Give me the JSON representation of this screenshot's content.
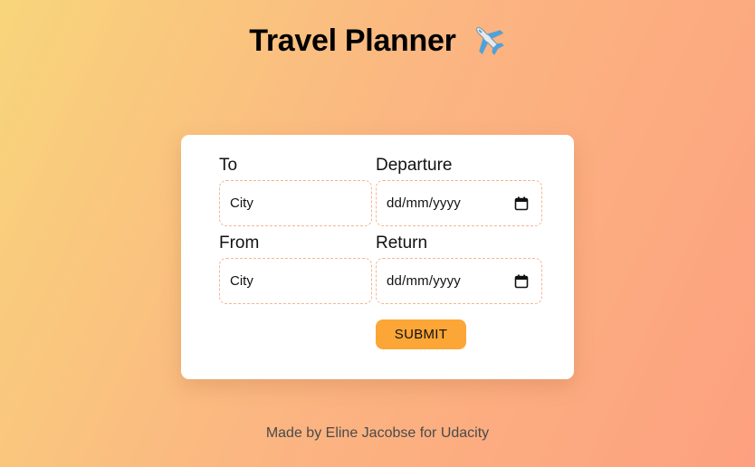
{
  "header": {
    "title": "Travel Planner",
    "icon": "airplane-icon"
  },
  "form": {
    "to_label": "To",
    "to_placeholder": "City",
    "departure_label": "Departure",
    "departure_value": "dd/mm/yyyy",
    "from_label": "From",
    "from_placeholder": "City",
    "return_label": "Return",
    "return_value": "dd/mm/yyyy",
    "submit_label": "SUBMIT"
  },
  "footer": {
    "text": "Made by Eline Jacobse for Udacity"
  },
  "colors": {
    "gradient_start": "#f8d57b",
    "gradient_end": "#fda07f",
    "card_bg": "#ffffff",
    "button_bg": "#fba636",
    "field_border": "#f5b691"
  }
}
